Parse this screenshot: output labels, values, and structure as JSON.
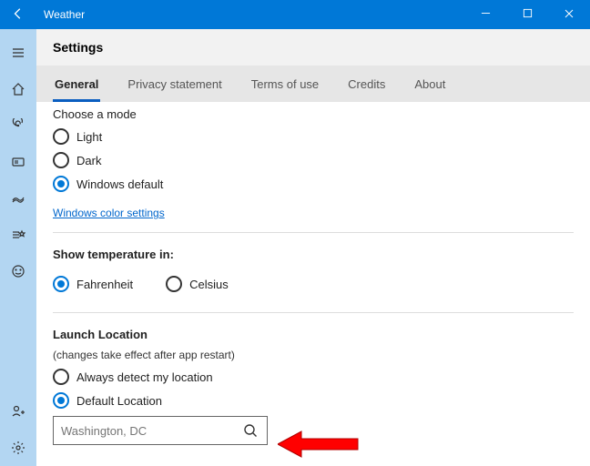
{
  "titlebar": {
    "title": "Weather"
  },
  "header": {
    "title": "Settings"
  },
  "tabs": [
    {
      "label": "General",
      "active": true
    },
    {
      "label": "Privacy statement",
      "active": false
    },
    {
      "label": "Terms of use",
      "active": false
    },
    {
      "label": "Credits",
      "active": false
    },
    {
      "label": "About",
      "active": false
    }
  ],
  "mode": {
    "heading": "Choose a mode",
    "options": [
      "Light",
      "Dark",
      "Windows default"
    ],
    "selected": "Windows default",
    "link": "Windows color settings"
  },
  "temperature": {
    "heading": "Show temperature in:",
    "options": [
      "Fahrenheit",
      "Celsius"
    ],
    "selected": "Fahrenheit"
  },
  "launch": {
    "heading": "Launch Location",
    "subtext": "(changes take effect after app restart)",
    "options": [
      "Always detect my location",
      "Default Location"
    ],
    "selected": "Default Location",
    "search_placeholder": "Washington, DC"
  }
}
